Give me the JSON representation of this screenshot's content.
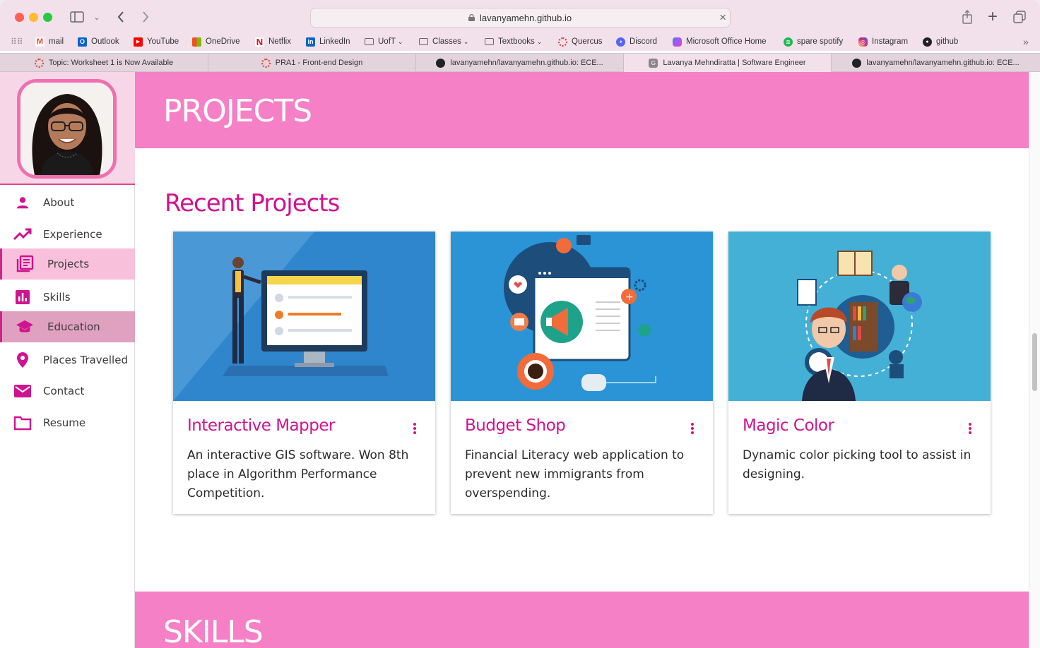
{
  "browser": {
    "url": "lavanyamehn.github.io",
    "bookmarks": [
      {
        "label": "mail",
        "icon": "gmail-icon",
        "color": "#ea4335"
      },
      {
        "label": "Outlook",
        "icon": "outlook-icon",
        "color": "#0a64c8"
      },
      {
        "label": "YouTube",
        "icon": "youtube-icon",
        "color": "#ff0000"
      },
      {
        "label": "OneDrive",
        "icon": "microsoft-icon",
        "color": "#f25022"
      },
      {
        "label": "Netflix",
        "icon": "netflix-icon",
        "color": "#e50914"
      },
      {
        "label": "LinkedIn",
        "icon": "linkedin-icon",
        "color": "#0a66c2"
      },
      {
        "label": "UofT",
        "icon": "folder-icon",
        "color": "#666666"
      },
      {
        "label": "Classes",
        "icon": "folder-icon",
        "color": "#666666"
      },
      {
        "label": "Textbooks",
        "icon": "folder-icon",
        "color": "#666666"
      },
      {
        "label": "Quercus",
        "icon": "quercus-icon",
        "color": "#e43a2e"
      },
      {
        "label": "Discord",
        "icon": "discord-icon",
        "color": "#5865f2"
      },
      {
        "label": "Microsoft Office Home",
        "icon": "office-icon",
        "color": "#7b4fd6"
      },
      {
        "label": "spare spotify",
        "icon": "spotify-icon",
        "color": "#1db954"
      },
      {
        "label": "Instagram",
        "icon": "instagram-icon",
        "color": "#d62976"
      },
      {
        "label": "github",
        "icon": "github-icon",
        "color": "#222222"
      }
    ],
    "tabs": [
      {
        "label": "Topic: Worksheet 1 is Now Available",
        "icon": "quercus-icon",
        "active": false
      },
      {
        "label": "PRA1 - Front-end Design",
        "icon": "quercus-icon",
        "active": false
      },
      {
        "label": "lavanyamehn/lavanyamehn.github.io: ECE...",
        "icon": "github-icon",
        "active": false
      },
      {
        "label": "Lavanya Mehndiratta | Software Engineer",
        "icon": "g-icon",
        "active": true
      },
      {
        "label": "lavanyamehn/lavanyamehn.github.io: ECE...",
        "icon": "github-icon",
        "active": false
      }
    ]
  },
  "sidebar": {
    "items": [
      {
        "label": "About",
        "icon": "person-icon"
      },
      {
        "label": "Experience",
        "icon": "trending-up-icon"
      },
      {
        "label": "Projects",
        "icon": "library-books-icon"
      },
      {
        "label": "Skills",
        "icon": "bar-chart-icon"
      },
      {
        "label": "Education",
        "icon": "school-icon"
      },
      {
        "label": "Places Travelled",
        "icon": "location-pin-icon"
      },
      {
        "label": "Contact",
        "icon": "mail-icon"
      },
      {
        "label": "Resume",
        "icon": "folder-icon"
      }
    ]
  },
  "main": {
    "section_title": "PROJECTS",
    "subtitle": "Recent Projects",
    "projects": [
      {
        "title": "Interactive Mapper",
        "description": "An interactive GIS software. Won 8th place in Algorithm Performance Competition."
      },
      {
        "title": "Budget Shop",
        "description": "Financial Literacy web application to prevent new immigrants from overspending."
      },
      {
        "title": "Magic Color",
        "description": "Dynamic color picking tool to assist in designing."
      }
    ],
    "next_section_title": "SKILLS"
  },
  "colors": {
    "accent": "#d0138f",
    "band": "#f580c6",
    "selected_nav": "#f9c0dc",
    "hover_nav": "#e0a1c1"
  }
}
